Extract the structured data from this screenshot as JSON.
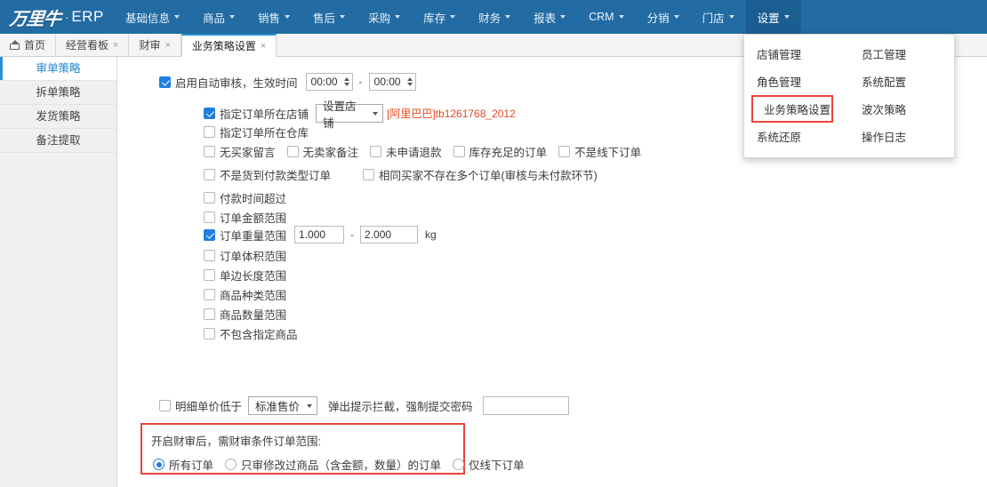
{
  "app": {
    "logo_text": "万里牛",
    "logo_dot": "·",
    "logo_suffix": "ERP"
  },
  "nav": {
    "items": [
      {
        "label": "基础信息",
        "active": false
      },
      {
        "label": "商品",
        "active": false
      },
      {
        "label": "销售",
        "active": false
      },
      {
        "label": "售后",
        "active": false
      },
      {
        "label": "采购",
        "active": false
      },
      {
        "label": "库存",
        "active": false
      },
      {
        "label": "财务",
        "active": false
      },
      {
        "label": "报表",
        "active": false
      },
      {
        "label": "CRM",
        "active": false
      },
      {
        "label": "分销",
        "active": false
      },
      {
        "label": "门店",
        "active": false
      },
      {
        "label": "设置",
        "active": true
      }
    ]
  },
  "dropdown": {
    "open_for": "设置",
    "items": [
      {
        "label": "店铺管理",
        "highlighted": false
      },
      {
        "label": "员工管理",
        "highlighted": false
      },
      {
        "label": "角色管理",
        "highlighted": false
      },
      {
        "label": "系统配置",
        "highlighted": false
      },
      {
        "label": "业务策略设置",
        "highlighted": true
      },
      {
        "label": "波次策略",
        "highlighted": false
      },
      {
        "label": "系统还原",
        "highlighted": false
      },
      {
        "label": "操作日志",
        "highlighted": false
      }
    ]
  },
  "tabs": {
    "home_label": "首页",
    "items": [
      {
        "label": "经营看板",
        "closable": true,
        "active": false
      },
      {
        "label": "财审",
        "closable": true,
        "active": false
      },
      {
        "label": "业务策略设置",
        "closable": true,
        "active": true
      }
    ],
    "close_glyph": "×"
  },
  "sidebar": {
    "items": [
      {
        "label": "审单策略",
        "active": true
      },
      {
        "label": "拆单策略",
        "active": false
      },
      {
        "label": "发货策略",
        "active": false
      },
      {
        "label": "备注提取",
        "active": false
      }
    ]
  },
  "form": {
    "auto_audit": {
      "checked": true,
      "label": "启用自动审核，生效时间",
      "time_from": "00:00",
      "time_to": "00:00",
      "separator": "-"
    },
    "shop_rule": {
      "checked": true,
      "label": "指定订单所在店铺",
      "select_value": "设置店铺",
      "shop_name": "[阿里巴巴]tb1261768_2012"
    },
    "warehouse_rule": {
      "checked": false,
      "label": "指定订单所在仓库"
    },
    "condition_row_1": [
      {
        "label": "无买家留言",
        "checked": false
      },
      {
        "label": "无卖家备注",
        "checked": false
      },
      {
        "label": "未申请退款",
        "checked": false
      },
      {
        "label": "库存充足的订单",
        "checked": false
      },
      {
        "label": "不是线下订单",
        "checked": false
      }
    ],
    "condition_row_2": [
      {
        "label": "不是货到付款类型订单",
        "checked": false
      },
      {
        "label": "相同买家不存在多个订单(审核与未付款环节)",
        "checked": false
      }
    ],
    "condition_rows": [
      {
        "label": "付款时间超过",
        "checked": false
      },
      {
        "label": "订单金额范围",
        "checked": false
      }
    ],
    "weight_rule": {
      "checked": true,
      "label": "订单重量范围",
      "min": "1.000",
      "max": "2.000",
      "separator": "-",
      "unit": "kg"
    },
    "condition_rows_after": [
      {
        "label": "订单体积范围",
        "checked": false
      },
      {
        "label": "单边长度范围",
        "checked": false
      },
      {
        "label": "商品种类范围",
        "checked": false
      },
      {
        "label": "商品数量范围",
        "checked": false
      },
      {
        "label": "不包含指定商品",
        "checked": false
      }
    ],
    "price_rule": {
      "checked": false,
      "label": "明细单价低于",
      "select_value": "标准售价",
      "tail_label": "弹出提示拦截，强制提交密码",
      "password_value": ""
    },
    "audit_scope": {
      "title": "开启财审后，需财审条件订单范围:",
      "options": [
        {
          "label": "所有订单",
          "selected": true
        },
        {
          "label": "只审修改过商品（含金额，数量）的订单",
          "selected": false
        },
        {
          "label": "仅线下订单",
          "selected": false
        }
      ]
    }
  },
  "colors": {
    "header_blue": "#226ba3",
    "header_active_blue": "#1b5e92",
    "accent_blue": "#1f7fe0",
    "highlight_red": "#e8453c",
    "shop_orange": "#e3491f",
    "sidebar_bg": "#f0f0f0"
  }
}
